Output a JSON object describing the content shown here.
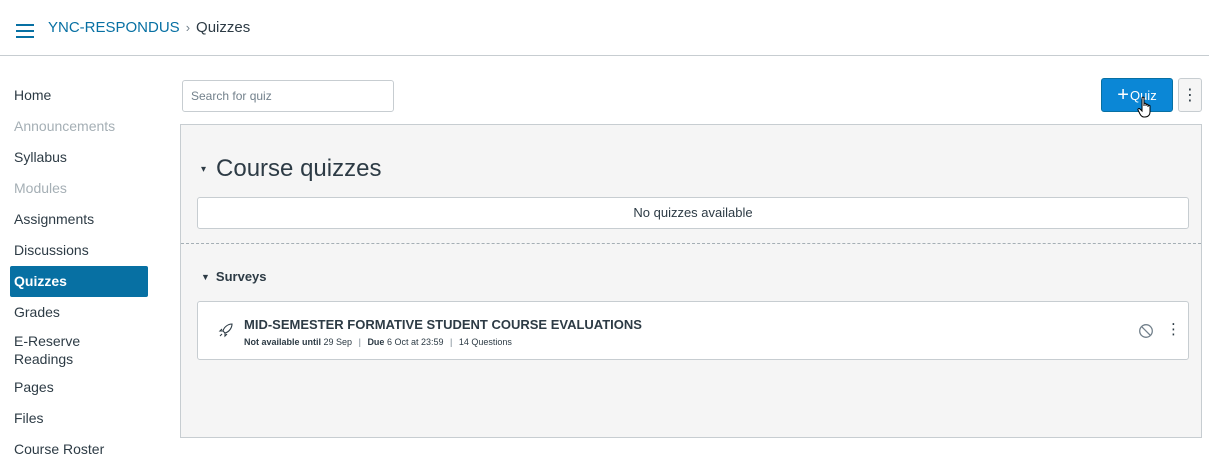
{
  "header": {
    "course_link": "YNC-RESPONDUS",
    "separator": "›",
    "current_page": "Quizzes"
  },
  "sidebar": {
    "items": [
      {
        "label": "Home",
        "state": "normal"
      },
      {
        "label": "Announcements",
        "state": "disabled"
      },
      {
        "label": "Syllabus",
        "state": "normal"
      },
      {
        "label": "Modules",
        "state": "disabled"
      },
      {
        "label": "Assignments",
        "state": "normal"
      },
      {
        "label": "Discussions",
        "state": "normal"
      },
      {
        "label": "Quizzes",
        "state": "active"
      },
      {
        "label": "Grades",
        "state": "normal"
      },
      {
        "label": "E-Reserve Readings",
        "state": "normal"
      },
      {
        "label": "Pages",
        "state": "normal"
      },
      {
        "label": "Files",
        "state": "normal"
      },
      {
        "label": "Course Roster",
        "state": "normal"
      }
    ]
  },
  "toolbar": {
    "search_placeholder": "Search for quiz",
    "add_quiz_label": "Quiz",
    "add_quiz_plus": "+",
    "kebab": "⋮"
  },
  "course_quizzes": {
    "title": "Course quizzes",
    "empty_message": "No quizzes available"
  },
  "surveys": {
    "title": "Surveys",
    "items": [
      {
        "title": "MID-SEMESTER FORMATIVE STUDENT COURSE EVALUATIONS",
        "availability_label": "Not available until",
        "availability_date": "29 Sep",
        "due_label": "Due",
        "due_date": "6 Oct at 23:59",
        "questions": "14 Questions",
        "meta_separator": "|"
      }
    ]
  },
  "colors": {
    "brand_link": "#0770a3",
    "primary_button": "#0b87d6",
    "active_nav": "#0770a3",
    "panel_bg": "#f5f5f5"
  }
}
